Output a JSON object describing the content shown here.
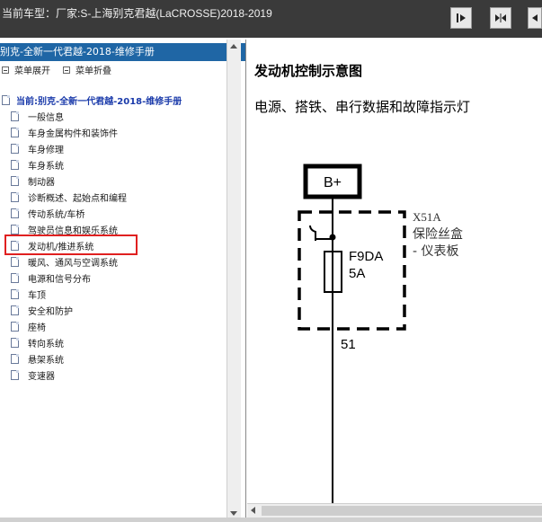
{
  "window": {
    "title": "当前车型：厂家:S-上海别克君越(LaCROSSE)2018-2019"
  },
  "left_panel": {
    "header": "别克-全新一代君越-2018-维修手册",
    "toolbar": {
      "expand": "菜单展开",
      "collapse": "菜单折叠"
    },
    "root": "当前:别克-全新一代君越-2018-维修手册",
    "items": [
      "一般信息",
      "车身金属构件和装饰件",
      "车身修理",
      "车身系统",
      "制动器",
      "诊断概述、起始点和编程",
      "传动系统/车桥",
      "驾驶员信息和娱乐系统",
      "发动机/推进系统",
      "暖风、通风与空调系统",
      "电源和信号分布",
      "车顶",
      "安全和防护",
      "座椅",
      "转向系统",
      "悬架系统",
      "变速器"
    ],
    "selected_index": 8
  },
  "document": {
    "title": "发动机控制示意图",
    "subtitle": "电源、搭铁、串行数据和故障指示灯",
    "diagram": {
      "power_label": "B+",
      "connector": "X51A",
      "fuse_box_line1": "保险丝盒",
      "fuse_box_line2": "- 仪表板",
      "fuse_name": "F9DA",
      "fuse_rating": "5A",
      "wire_number": "51"
    }
  },
  "colors": {
    "title_bar": "#3a3a3a",
    "panel_header": "#1f66a5",
    "selection_border": "#e02020",
    "tree_root": "#1a3aaa"
  }
}
